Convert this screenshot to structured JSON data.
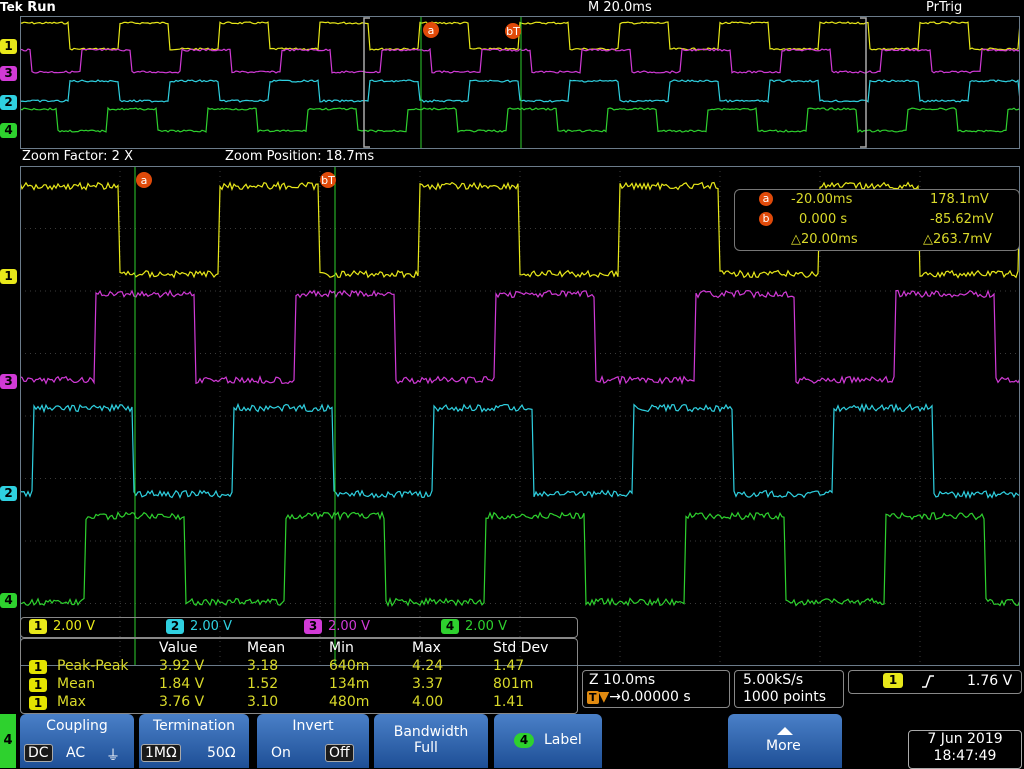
{
  "status": {
    "brand": "Tek",
    "state": "Run",
    "timebase": "M 20.0ms",
    "trigger_state": "PrTrig"
  },
  "zoom": {
    "factor": "Zoom Factor: 2 X",
    "position": "Zoom Position: 18.7ms"
  },
  "channels": [
    {
      "id": "1",
      "color": "#e8e81a",
      "scale": "2.00 V"
    },
    {
      "id": "2",
      "color": "#2fd0e0",
      "scale": "2.00 V"
    },
    {
      "id": "3",
      "color": "#d13ad6",
      "scale": "2.00 V"
    },
    {
      "id": "4",
      "color": "#2ed12e",
      "scale": "2.00 V"
    }
  ],
  "cursors": {
    "a": {
      "label": "a",
      "time": "-20.00ms",
      "value": "178.1mV"
    },
    "b": {
      "label": "b",
      "time": "0.000 s",
      "value": "-85.62mV"
    },
    "delta": {
      "time": "△20.00ms",
      "value": "△263.7mV"
    },
    "trigger_marker": "bT"
  },
  "measurements": {
    "headers": [
      "Value",
      "Mean",
      "Min",
      "Max",
      "Std Dev"
    ],
    "rows": [
      {
        "ch": "1",
        "name": "Peak-Peak",
        "value": "3.92 V",
        "mean": "3.18",
        "min": "640m",
        "max": "4.24",
        "std": "1.47"
      },
      {
        "ch": "1",
        "name": "Mean",
        "value": "1.84 V",
        "mean": "1.52",
        "min": "134m",
        "max": "3.37",
        "std": "801m"
      },
      {
        "ch": "1",
        "name": "Max",
        "value": "3.76 V",
        "mean": "3.10",
        "min": "480m",
        "max": "4.00",
        "std": "1.41"
      }
    ]
  },
  "zoom_readout": {
    "line1": "Z 10.0ms",
    "line2": "→0.00000 s",
    "trigger_icon": "T"
  },
  "acquisition": {
    "rate": "5.00kS/s",
    "points": "1000 points"
  },
  "trigger": {
    "channel": "1",
    "slope_icon": "rising-edge-icon",
    "level": "1.76 V"
  },
  "menu": {
    "side_channel": "4",
    "coupling": {
      "title": "Coupling",
      "options": [
        "DC",
        "AC",
        "⏚"
      ],
      "selected": 0
    },
    "termination": {
      "title": "Termination",
      "options": [
        "1MΩ",
        "50Ω"
      ],
      "selected": 0
    },
    "invert": {
      "title": "Invert",
      "options": [
        "On",
        "Off"
      ],
      "selected": 1
    },
    "bandwidth": {
      "title": "Bandwidth",
      "value": "Full"
    },
    "label": {
      "channel": "4",
      "text": "Label"
    },
    "more": {
      "text": "More"
    }
  },
  "datetime": {
    "date": "7 Jun 2019",
    "time": "18:47:49"
  }
}
